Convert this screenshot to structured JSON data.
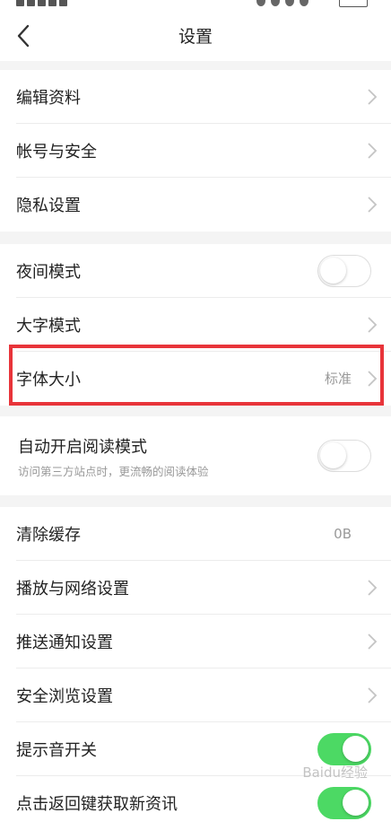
{
  "header": {
    "title": "设置",
    "back_icon": "chevron-left-icon"
  },
  "groups": [
    {
      "items": [
        {
          "label": "编辑资料",
          "control": "chevron"
        },
        {
          "label": "帐号与安全",
          "control": "chevron"
        },
        {
          "label": "隐私设置",
          "control": "chevron"
        }
      ]
    },
    {
      "items": [
        {
          "label": "夜间模式",
          "control": "toggle",
          "on": false
        },
        {
          "label": "大字模式",
          "control": "chevron"
        },
        {
          "label": "字体大小",
          "control": "chevron",
          "value": "标准",
          "highlighted": true
        }
      ]
    },
    {
      "items": [
        {
          "label": "自动开启阅读模式",
          "subtitle": "访问第三方站点时，更流畅的阅读体验",
          "control": "toggle",
          "on": false
        }
      ]
    },
    {
      "items": [
        {
          "label": "清除缓存",
          "control": "value",
          "value": "0B"
        },
        {
          "label": "播放与网络设置",
          "control": "chevron"
        },
        {
          "label": "推送通知设置",
          "control": "chevron"
        },
        {
          "label": "安全浏览设置",
          "control": "chevron"
        },
        {
          "label": "提示音开关",
          "control": "toggle",
          "on": true
        },
        {
          "label": "点击返回键获取新资讯",
          "control": "toggle",
          "on": true
        }
      ]
    }
  ],
  "colors": {
    "toggle_on": "#4cd964",
    "highlight_box": "#e8343a"
  },
  "watermark": "Baidu经验"
}
